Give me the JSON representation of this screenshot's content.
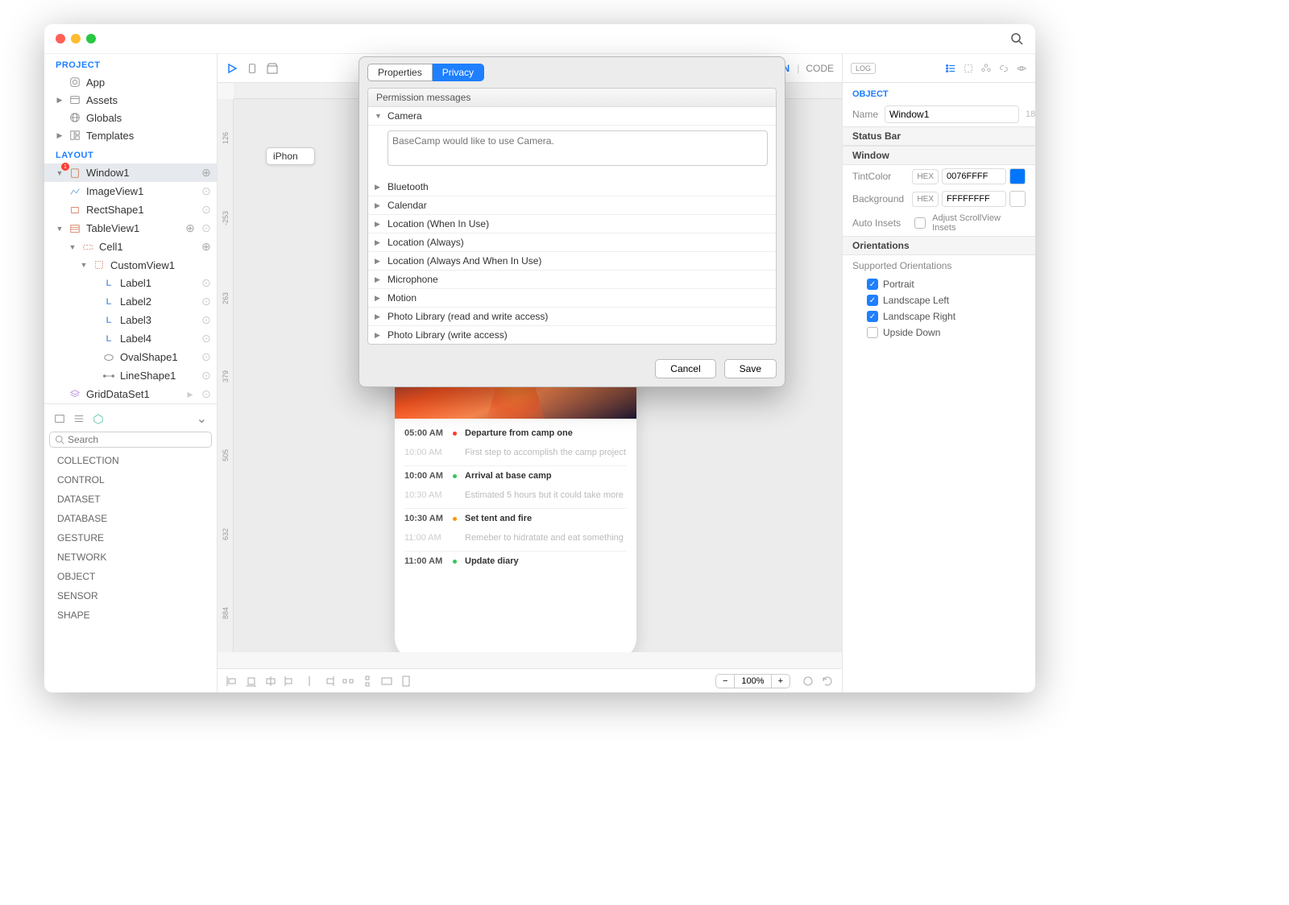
{
  "sidebar": {
    "sections": {
      "project": "PROJECT",
      "layout": "LAYOUT"
    },
    "project_items": [
      {
        "label": "App",
        "icon": "app"
      },
      {
        "label": "Assets",
        "icon": "assets"
      },
      {
        "label": "Globals",
        "icon": "globals"
      },
      {
        "label": "Templates",
        "icon": "templates"
      }
    ],
    "layout_items": [
      {
        "label": "Window1",
        "badge": "1"
      },
      {
        "label": "ImageView1"
      },
      {
        "label": "RectShape1"
      },
      {
        "label": "TableView1"
      },
      {
        "label": "Cell1"
      },
      {
        "label": "CustomView1"
      },
      {
        "label": "Label1"
      },
      {
        "label": "Label2"
      },
      {
        "label": "Label3"
      },
      {
        "label": "Label4"
      },
      {
        "label": "OvalShape1"
      },
      {
        "label": "LineShape1"
      },
      {
        "label": "GridDataSet1"
      }
    ],
    "search_placeholder": "Search",
    "categories": [
      "COLLECTION",
      "CONTROL",
      "DATASET",
      "DATABASE",
      "GESTURE",
      "NETWORK",
      "OBJECT",
      "SENSOR",
      "SHAPE"
    ]
  },
  "canvas": {
    "toolbar_right": {
      "design": "N",
      "code": "CODE"
    },
    "device": "iPhon",
    "ruler_v": [
      "126",
      "-253",
      "263",
      "379",
      "505",
      "632",
      "884"
    ],
    "phone_events": [
      {
        "t1": "05:00 AM",
        "t2": "10:00 AM",
        "title": "Departure from camp one",
        "sub": "First step to accomplish the camp project",
        "dot": "#ff3b30"
      },
      {
        "t1": "10:00 AM",
        "t2": "10:30 AM",
        "title": "Arrival at base camp",
        "sub": "Estimated 5 hours but it could take more",
        "dot": "#34c759"
      },
      {
        "t1": "10:30 AM",
        "t2": "11:00 AM",
        "title": "Set tent and fire",
        "sub": "Remeber to hidratate and eat something",
        "dot": "#ff9500"
      },
      {
        "t1": "11:00 AM",
        "t2": "",
        "title": "Update diary",
        "sub": "",
        "dot": "#34c759"
      }
    ],
    "zoom": "100%"
  },
  "inspector": {
    "log": "LOG",
    "object_title": "OBJECT",
    "name_label": "Name",
    "name_value": "Window1",
    "name_count": "18",
    "statusbar": "Status Bar",
    "window": "Window",
    "tint_label": "TintColor",
    "tint_hex": "HEX",
    "tint_value": "0076FFFF",
    "bg_label": "Background",
    "bg_hex": "HEX",
    "bg_value": "FFFFFFFF",
    "auto_insets": "Auto Insets",
    "auto_insets_opt": "Adjust ScrollView Insets",
    "orientations": "Orientations",
    "supported": "Supported Orientations",
    "opts": [
      {
        "label": "Portrait",
        "checked": true
      },
      {
        "label": "Landscape Left",
        "checked": true
      },
      {
        "label": "Landscape Right",
        "checked": true
      },
      {
        "label": "Upside Down",
        "checked": false
      }
    ]
  },
  "modal": {
    "tab_props": "Properties",
    "tab_privacy": "Privacy",
    "section": "Permission messages",
    "camera": "Camera",
    "camera_msg": "BaseCamp would like to use Camera.",
    "perms": [
      "Bluetooth",
      "Calendar",
      "Location (When In Use)",
      "Location (Always)",
      "Location (Always And When In Use)",
      "Microphone",
      "Motion",
      "Photo Library (read and write access)",
      "Photo Library (write access)"
    ],
    "cancel": "Cancel",
    "save": "Save"
  }
}
